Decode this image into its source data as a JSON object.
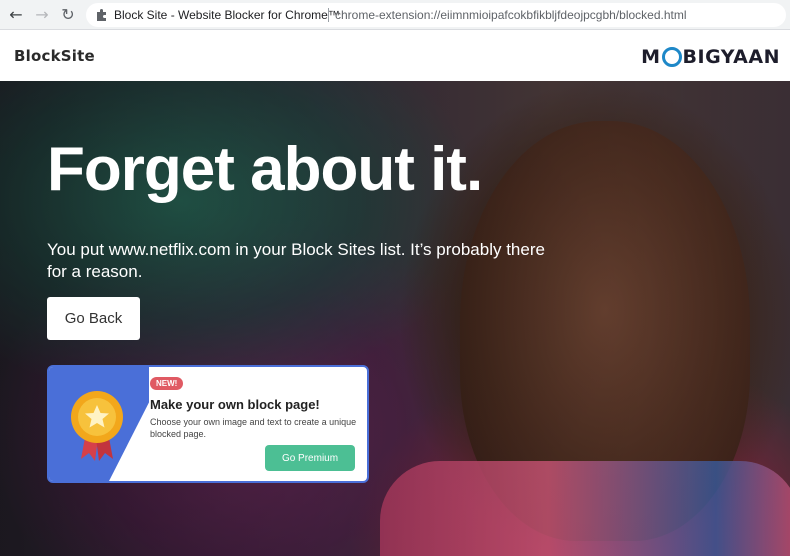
{
  "browser": {
    "tab_title": "Block Site - Website Blocker for Chrome™",
    "url": "chrome-extension://eiimnmioipafcokbfikbljfdeojpcgbh/blocked.html"
  },
  "header": {
    "brand": "BlockSite",
    "watermark_a": "M",
    "watermark_b": "BIGYAAN"
  },
  "hero": {
    "headline": "Forget about it.",
    "message": "You put www.netflix.com in your Block Sites list. It’s probably there for a reason.",
    "go_back_label": "Go Back"
  },
  "promo": {
    "badge": "NEW!",
    "title": "Make your own block page!",
    "text": "Choose your own image and text to create a unique blocked page.",
    "button_label": "Go Premium"
  },
  "colors": {
    "promo_accent": "#4a6fd8",
    "premium_button": "#4cbf94",
    "badge": "#e05a63"
  }
}
